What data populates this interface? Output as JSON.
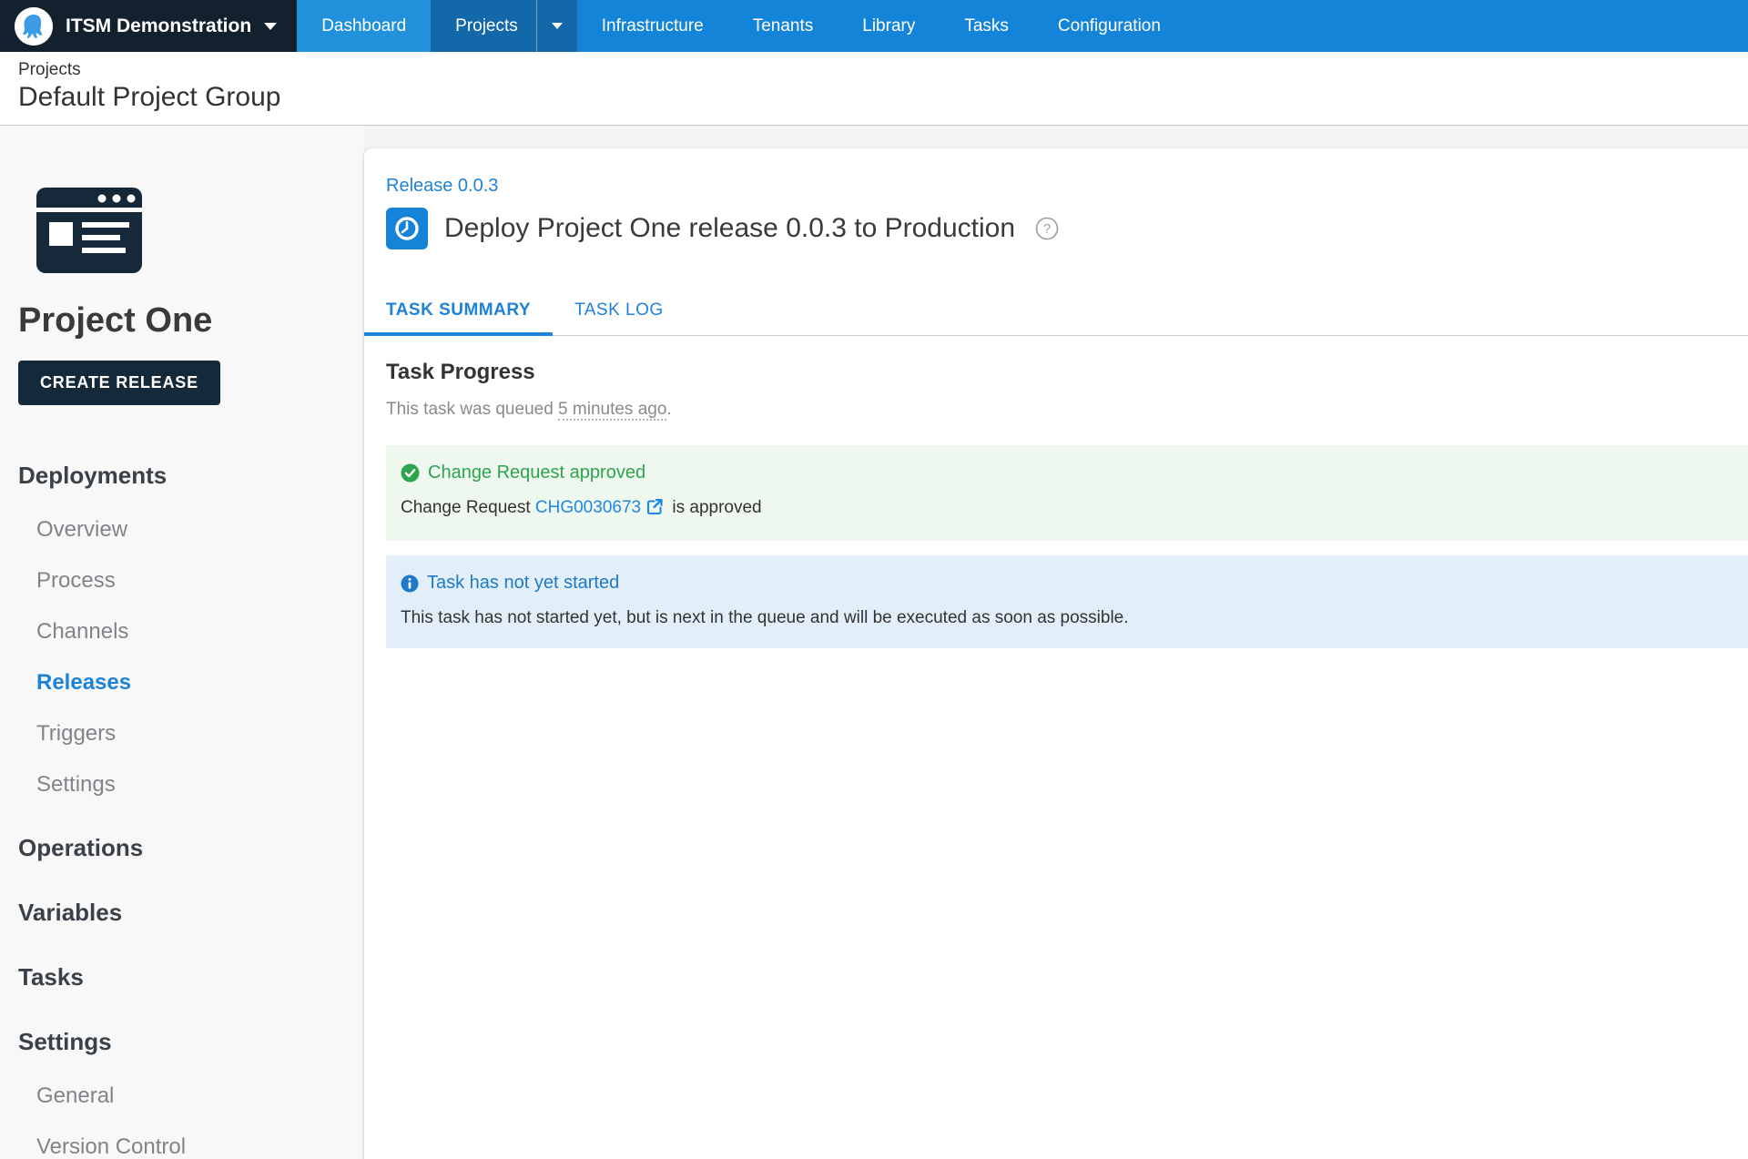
{
  "navbar": {
    "brand": "ITSM Demonstration",
    "items": [
      {
        "label": "Dashboard"
      },
      {
        "label": "Projects"
      },
      {
        "label": "Infrastructure"
      },
      {
        "label": "Tenants"
      },
      {
        "label": "Library"
      },
      {
        "label": "Tasks"
      },
      {
        "label": "Configuration"
      }
    ]
  },
  "breadcrumb": {
    "section": "Projects",
    "title": "Default Project Group"
  },
  "sidebar": {
    "project_name": "Project One",
    "create_release_label": "CREATE RELEASE",
    "items": [
      {
        "label": "Deployments"
      },
      {
        "label": "Overview"
      },
      {
        "label": "Process"
      },
      {
        "label": "Channels"
      },
      {
        "label": "Releases",
        "active": true
      },
      {
        "label": "Triggers"
      },
      {
        "label": "Settings"
      },
      {
        "label": "Operations"
      },
      {
        "label": "Variables"
      },
      {
        "label": "Tasks"
      },
      {
        "label": "Settings"
      },
      {
        "label": "General"
      },
      {
        "label": "Version Control"
      }
    ]
  },
  "main": {
    "release_link": "Release 0.0.3",
    "title": "Deploy Project One release 0.0.3 to Production",
    "tabs": [
      {
        "label": "TASK SUMMARY",
        "active": true
      },
      {
        "label": "TASK LOG",
        "active": false
      }
    ],
    "section_title": "Task Progress",
    "queued_prefix": "This task was queued ",
    "queued_time": "5 minutes ago",
    "queued_suffix": ".",
    "alerts": {
      "approved": {
        "title": "Change Request approved",
        "body_prefix": "Change Request ",
        "link": "CHG0030673",
        "body_suffix": " is approved"
      },
      "not_started": {
        "title": "Task has not yet started",
        "body": "This task has not started yet, but is next in the queue and will be executed as soon as possible."
      }
    }
  },
  "colors": {
    "navbar_blue": "#1484d8",
    "navbar_dark": "#13212e",
    "nav_active_blue": "#1268a8",
    "nav_hover_blue": "#2191dc",
    "accent_blue": "#1e82d8",
    "link_blue": "#1e87e5",
    "success_green": "#2da44e",
    "success_bg": "#eff8ef",
    "info_blue": "#1e7ac9",
    "info_bg": "#e2eef9",
    "button_navy": "#14293a"
  }
}
